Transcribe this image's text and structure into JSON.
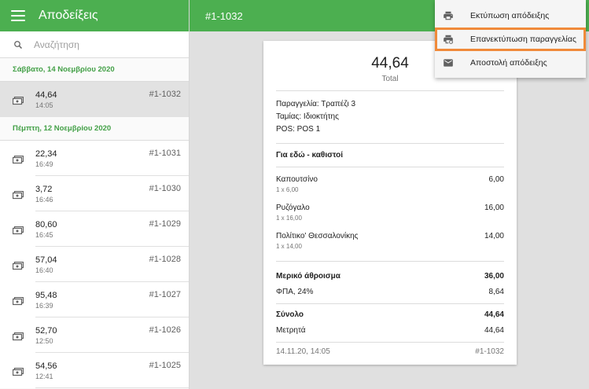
{
  "app": {
    "title": "Αποδείξεις"
  },
  "search": {
    "placeholder": "Αναζήτηση"
  },
  "groups": [
    {
      "date": "Σάββατο, 14 Νοεμβρίου 2020",
      "receipts": [
        {
          "amount": "44,64",
          "time": "14:05",
          "number": "#1-1032",
          "selected": true
        }
      ]
    },
    {
      "date": "Πέμπτη, 12 Νοεμβρίου 2020",
      "receipts": [
        {
          "amount": "22,34",
          "time": "16:49",
          "number": "#1-1031"
        },
        {
          "amount": "3,72",
          "time": "16:46",
          "number": "#1-1030"
        },
        {
          "amount": "80,60",
          "time": "16:45",
          "number": "#1-1029"
        },
        {
          "amount": "57,04",
          "time": "16:40",
          "number": "#1-1028"
        },
        {
          "amount": "95,48",
          "time": "16:39",
          "number": "#1-1027"
        },
        {
          "amount": "52,70",
          "time": "12:50",
          "number": "#1-1026"
        },
        {
          "amount": "54,56",
          "time": "12:41",
          "number": "#1-1025"
        }
      ]
    }
  ],
  "detail": {
    "header": "#1-1032",
    "total": "44,64",
    "total_label": "Total",
    "order": "Παραγγελία: Τραπέζι 3",
    "cashier": "Ταμίας: Ιδιοκτήτης",
    "pos": "POS: POS 1",
    "dining": "Για εδώ - καθιστοί",
    "items": [
      {
        "name": "Καπουτσίνο",
        "qty": "1 x 6,00",
        "price": "6,00"
      },
      {
        "name": "Ρυζόγαλο",
        "qty": "1 x 16,00",
        "price": "16,00"
      },
      {
        "name": "Πολίτικο' Θεσσαλονίκης",
        "qty": "1 x 14,00",
        "price": "14,00"
      }
    ],
    "subtotal_label": "Μερικό άθροισμα",
    "subtotal": "36,00",
    "vat_label": "ΦΠΑ, 24%",
    "vat": "8,64",
    "sum_label": "Σύνολο",
    "sum": "44,64",
    "cash_label": "Μετρητά",
    "cash": "44,64",
    "datetime": "14.11.20, 14:05",
    "number": "#1-1032"
  },
  "menu": {
    "items": [
      {
        "label": "Εκτύπωση απόδειξης",
        "icon": "print-icon"
      },
      {
        "label": "Επανεκτύπωση παραγγελίας",
        "icon": "reprint-icon",
        "highlighted": true
      },
      {
        "label": "Αποστολή απόδειξης",
        "icon": "mail-icon"
      }
    ]
  },
  "colors": {
    "primary": "#4caf50",
    "accent_text": "#43a047",
    "highlight": "#f08a3a"
  }
}
